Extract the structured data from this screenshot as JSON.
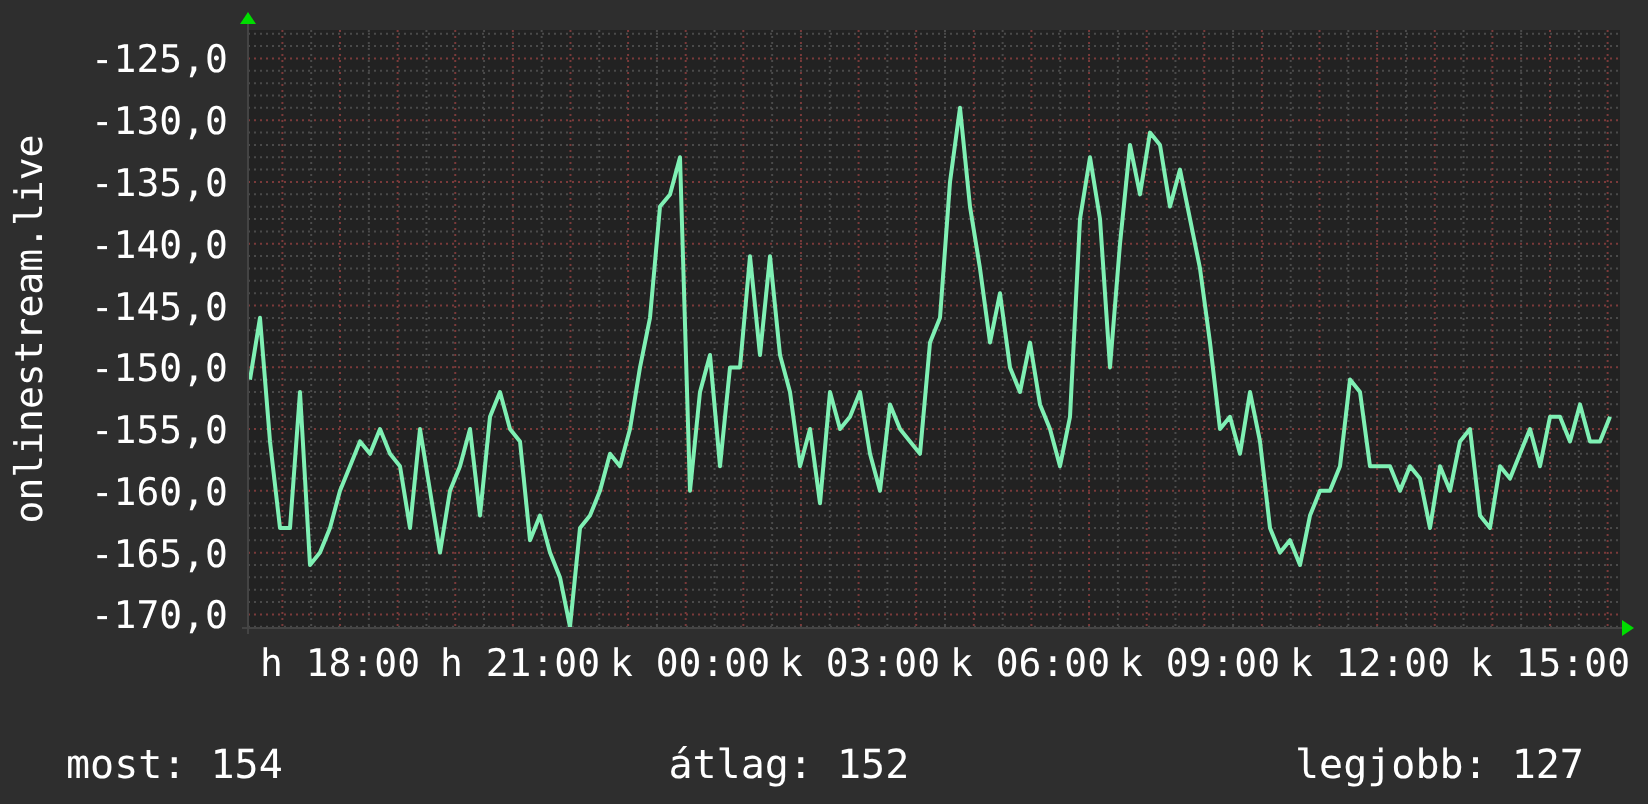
{
  "chart_data": {
    "type": "line",
    "ylabel": "onlinestream.live",
    "grid": true,
    "ylim": [
      -171.1,
      -122.7
    ],
    "yticks": [
      {
        "value": -125,
        "label": "-125,0"
      },
      {
        "value": -130,
        "label": "-130,0"
      },
      {
        "value": -135,
        "label": "-135,0"
      },
      {
        "value": -140,
        "label": "-140,0"
      },
      {
        "value": -145,
        "label": "-145,0"
      },
      {
        "value": -150,
        "label": "-150,0"
      },
      {
        "value": -155,
        "label": "-155,0"
      },
      {
        "value": -160,
        "label": "-160,0"
      },
      {
        "value": -165,
        "label": "-165,0"
      },
      {
        "value": -170,
        "label": "-170,0"
      }
    ],
    "categories": [
      null,
      null,
      null,
      null,
      null,
      null,
      null,
      null,
      null,
      "h 18:00",
      null,
      null,
      null,
      null,
      null,
      null,
      null,
      null,
      null,
      null,
      null,
      null,
      null,
      null,
      null,
      null,
      null,
      "h 21:00",
      null,
      null,
      null,
      null,
      null,
      null,
      null,
      null,
      null,
      null,
      null,
      null,
      null,
      null,
      null,
      null,
      "k 00:00",
      null,
      null,
      null,
      null,
      null,
      null,
      null,
      null,
      null,
      null,
      null,
      null,
      null,
      null,
      null,
      null,
      "k 03:00",
      null,
      null,
      null,
      null,
      null,
      null,
      null,
      null,
      null,
      null,
      null,
      null,
      null,
      null,
      null,
      null,
      "k 06:00",
      null,
      null,
      null,
      null,
      null,
      null,
      null,
      null,
      null,
      null,
      null,
      null,
      null,
      null,
      null,
      null,
      "k 09:00",
      null,
      null,
      null,
      null,
      null,
      null,
      null,
      null,
      null,
      null,
      null,
      null,
      null,
      null,
      null,
      null,
      "k 12:00",
      null,
      null,
      null,
      null,
      null,
      null,
      null,
      null,
      null,
      null,
      null,
      null,
      null,
      null,
      null,
      null,
      null,
      "k 15:00",
      null,
      null,
      null,
      null,
      null,
      null
    ],
    "series": [
      {
        "color": "#7ff0b4",
        "values": [
          -151,
          -146,
          -156,
          -163,
          -163,
          -152,
          -166,
          -165,
          -163,
          -160,
          -158,
          -156,
          -157,
          -155,
          -157,
          -158,
          -163,
          -155,
          -160,
          -165,
          -160,
          -158,
          -155,
          -162,
          -154,
          -152,
          -155,
          -156,
          -164,
          -162,
          -165,
          -167,
          -171,
          -163,
          -162,
          -160,
          -157,
          -158,
          -155,
          -150,
          -146,
          -137,
          -136,
          -133,
          -160,
          -152,
          -149,
          -158,
          -150,
          -150,
          -141,
          -149,
          -141,
          -149,
          -152,
          -158,
          -155,
          -161,
          -152,
          -155,
          -154,
          -152,
          -157,
          -160,
          -153,
          -155,
          -156,
          -157,
          -148,
          -146,
          -135,
          -129,
          -137,
          -142,
          -148,
          -144,
          -150,
          -152,
          -148,
          -153,
          -155,
          -158,
          -154,
          -138,
          -133,
          -138,
          -150,
          -140,
          -132,
          -136,
          -131,
          -132,
          -137,
          -134,
          -138,
          -142,
          -148,
          -155,
          -154,
          -157,
          -152,
          -156,
          -163,
          -165,
          -164,
          -166,
          -162,
          -160,
          -160,
          -158,
          -151,
          -152,
          -158,
          -158,
          -158,
          -160,
          -158,
          -159,
          -163,
          -158,
          -160,
          -156,
          -155,
          -162,
          -163,
          -158,
          -159,
          -157,
          -155,
          -158,
          -154,
          -154,
          -156,
          -153,
          -156,
          -156,
          -154
        ]
      }
    ]
  },
  "legend": [
    "most: 154",
    "átlag: 152",
    "legjobb: 127"
  ]
}
